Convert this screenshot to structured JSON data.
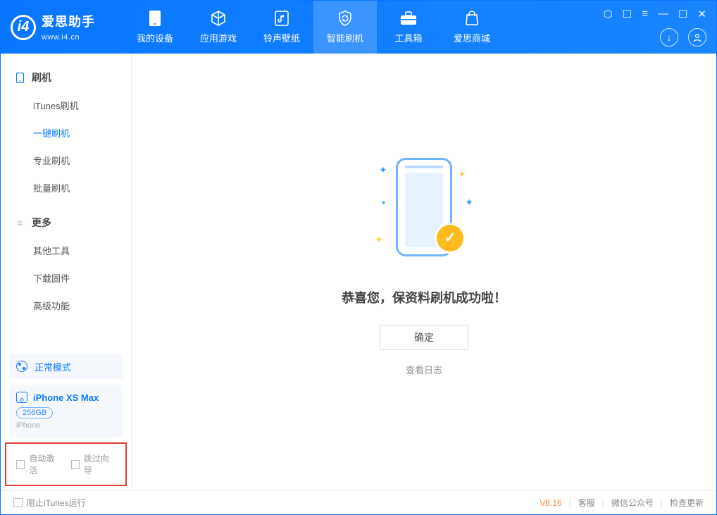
{
  "brand": {
    "title": "爱思助手",
    "url": "www.i4.cn",
    "logo_letter": "i4"
  },
  "nav": {
    "items": [
      {
        "label": "我的设备"
      },
      {
        "label": "应用游戏"
      },
      {
        "label": "铃声壁纸"
      },
      {
        "label": "智能刷机"
      },
      {
        "label": "工具箱"
      },
      {
        "label": "爱思商城"
      }
    ],
    "active_index": 3
  },
  "sidebar": {
    "groups": [
      {
        "title": "刷机",
        "items": [
          "iTunes刷机",
          "一键刷机",
          "专业刷机",
          "批量刷机"
        ],
        "active_index": 1
      },
      {
        "title": "更多",
        "items": [
          "其他工具",
          "下载固件",
          "高级功能"
        ],
        "active_index": -1
      }
    ]
  },
  "mode_label": "正常模式",
  "device": {
    "name": "iPhone XS Max",
    "capacity": "256GB",
    "type": "iPhone"
  },
  "checks": {
    "auto_activate": "自动激活",
    "skip_guide": "跳过向导"
  },
  "main": {
    "message": "恭喜您，保资料刷机成功啦！",
    "ok": "确定",
    "view_log": "查看日志"
  },
  "footer": {
    "block_itunes": "阻止iTunes运行",
    "version": "V8.16",
    "support": "客服",
    "wechat": "微信公众号",
    "check_update": "检查更新"
  }
}
